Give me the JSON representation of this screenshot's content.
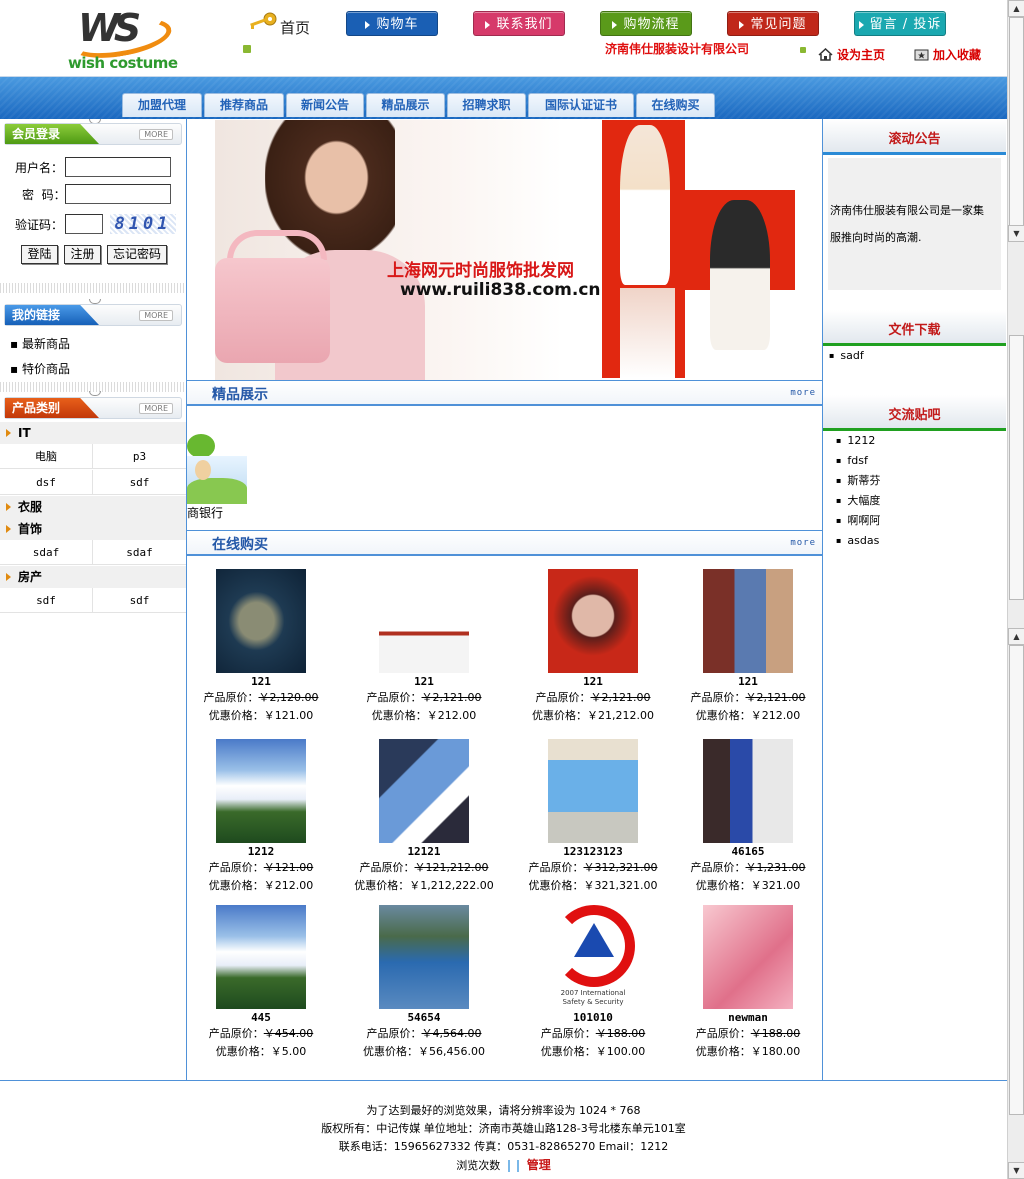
{
  "header": {
    "logo_text": "wish costume",
    "logo_glyph": "WS",
    "home_label": "首页",
    "company": "济南伟仕服装设计有限公司",
    "set_home": "设为主页",
    "add_fav": "加入收藏",
    "buttons": [
      {
        "label": "购物车",
        "color": "#1a5fb4"
      },
      {
        "label": "联系我们",
        "color": "#d63a6a"
      },
      {
        "label": "购物流程",
        "color": "#5a9a1a"
      },
      {
        "label": "常见问题",
        "color": "#c0281a"
      },
      {
        "label": "留言 / 投诉",
        "color": "#1aa8b0"
      }
    ]
  },
  "nav": {
    "tabs": [
      "加盟代理",
      "推荐商品",
      "新闻公告",
      "精品展示",
      "招聘求职",
      "国际认证证书",
      "在线购买"
    ]
  },
  "login": {
    "title": "会员登录",
    "more": "MORE",
    "username_label": "用户名：",
    "password_label": "密  码：",
    "captcha_label": "验证码：",
    "captcha_value": "8101",
    "login_btn": "登陆",
    "register_btn": "注册",
    "forgot_btn": "忘记密码"
  },
  "mylinks": {
    "title": "我的链接",
    "more": "MORE",
    "items": [
      "最新商品",
      "特价商品"
    ]
  },
  "categories": {
    "title": "产品类别",
    "more": "MORE",
    "groups": [
      {
        "name": "IT",
        "rows": [
          [
            "电脑",
            "p3"
          ],
          [
            "dsf",
            "sdf"
          ]
        ]
      },
      {
        "name": "衣服",
        "rows": []
      },
      {
        "name": "首饰",
        "rows": [
          [
            "sdaf",
            "sdaf"
          ]
        ]
      },
      {
        "name": "房产",
        "rows": [
          [
            "sdf",
            "sdf"
          ]
        ]
      }
    ]
  },
  "banner": {
    "headline": "上海网元时尚服饰批发网",
    "url": "www.ruili838.com.cn"
  },
  "featured": {
    "title": "精品展示",
    "more": "more",
    "item_caption": "商银行"
  },
  "online": {
    "title": "在线购买",
    "more": "more",
    "orig_label": "产品原价：",
    "disc_label": "优惠价格：",
    "products": [
      {
        "name": "121",
        "orig": "￥2,120.00",
        "disc": "￥121.00",
        "img": "map"
      },
      {
        "name": "121",
        "orig": "￥2,121.00",
        "disc": "￥212.00",
        "img": "board"
      },
      {
        "name": "121",
        "orig": "￥2,121.00",
        "disc": "￥21,212.00",
        "img": "face"
      },
      {
        "name": "121",
        "orig": "￥2,121.00",
        "disc": "￥212.00",
        "img": "man"
      },
      {
        "name": "1212",
        "orig": "￥121.00",
        "disc": "￥212.00",
        "img": "sky"
      },
      {
        "name": "12121",
        "orig": "￥121,212.00",
        "disc": "￥1,212,222.00",
        "img": "statue"
      },
      {
        "name": "123123123",
        "orig": "￥312,321.00",
        "disc": "￥321,321.00",
        "img": "billboard"
      },
      {
        "name": "46165",
        "orig": "￥1,231.00",
        "disc": "￥321.00",
        "img": "guard"
      },
      {
        "name": "445",
        "orig": "￥454.00",
        "disc": "￥5.00",
        "img": "sky"
      },
      {
        "name": "54654",
        "orig": "￥4,564.00",
        "disc": "￥56,456.00",
        "img": "lake"
      },
      {
        "name": "101010",
        "orig": "￥188.00",
        "disc": "￥100.00",
        "img": "logo"
      },
      {
        "name": "newman",
        "orig": "￥188.00",
        "disc": "￥180.00",
        "img": "pink"
      }
    ],
    "logo_img_text": [
      "2007  International",
      "Safety & Security"
    ]
  },
  "right": {
    "notice_title": "滚动公告",
    "notice_text": "济南伟仕服装有限公司是一家集",
    "notice_text2": "服推向时尚的高潮.",
    "download_title": "文件下载",
    "downloads": [
      "sadf"
    ],
    "forum_title": "交流贴吧",
    "forum_items": [
      "1212",
      "fdsf",
      "斯蒂芬",
      "大幅度",
      "啊啊阿",
      "asdas"
    ]
  },
  "footer": {
    "line1": "为了达到最好的浏览效果，请将分辨率设为 1024 * 768",
    "line2": "版权所有：中记传媒 单位地址：济南市英雄山路128-3号北楼东单元101室",
    "line3": "联系电话：15965627332  传真：0531-82865270  Email：1212",
    "visits_label": "浏览次数",
    "admin": "管理"
  }
}
